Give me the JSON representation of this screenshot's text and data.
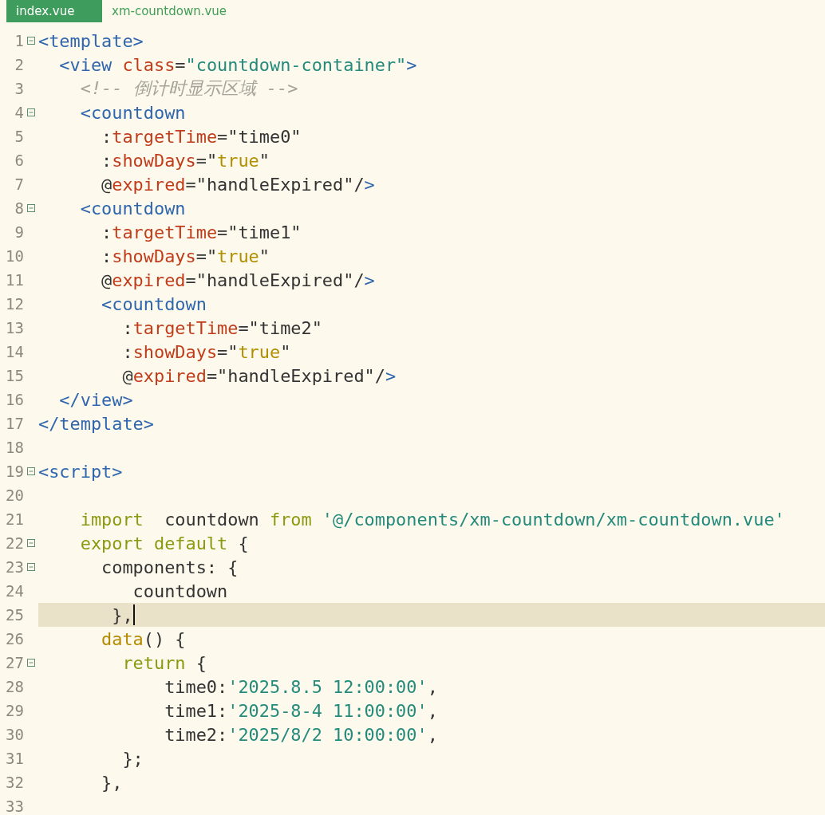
{
  "tabs": [
    {
      "label": "index.vue",
      "selected": true
    },
    {
      "label": "xm-countdown.vue",
      "selected": false
    }
  ],
  "editor": {
    "lines": [
      {
        "number": "1",
        "fold": true,
        "current": false,
        "tokens": [
          {
            "kind": "tag",
            "text": "<template>"
          }
        ]
      },
      {
        "number": "2",
        "fold": false,
        "current": false,
        "tokens": [
          {
            "kind": "tag",
            "text": "  <view "
          },
          {
            "kind": "attr",
            "text": "class"
          },
          {
            "kind": "plain",
            "text": "="
          },
          {
            "kind": "string",
            "text": "\"countdown-container\""
          },
          {
            "kind": "tag",
            "text": ">"
          }
        ]
      },
      {
        "number": "3",
        "fold": false,
        "current": false,
        "tokens": [
          {
            "kind": "comment",
            "text": "    <!-- 倒计时显示区域 -->"
          }
        ]
      },
      {
        "number": "4",
        "fold": true,
        "current": false,
        "tokens": [
          {
            "kind": "tag",
            "text": "    <countdown"
          }
        ]
      },
      {
        "number": "5",
        "fold": false,
        "current": false,
        "tokens": [
          {
            "kind": "plain",
            "text": "      :"
          },
          {
            "kind": "attr",
            "text": "targetTime"
          },
          {
            "kind": "plain",
            "text": "=\"time0\""
          }
        ]
      },
      {
        "number": "6",
        "fold": false,
        "current": false,
        "tokens": [
          {
            "kind": "plain",
            "text": "      :"
          },
          {
            "kind": "attr",
            "text": "showDays"
          },
          {
            "kind": "plain",
            "text": "=\""
          },
          {
            "kind": "bool",
            "text": "true"
          },
          {
            "kind": "plain",
            "text": "\""
          }
        ]
      },
      {
        "number": "7",
        "fold": false,
        "current": false,
        "tokens": [
          {
            "kind": "plain",
            "text": "      @"
          },
          {
            "kind": "attr",
            "text": "expired"
          },
          {
            "kind": "plain",
            "text": "=\"handleExpired\"/"
          },
          {
            "kind": "tag",
            "text": ">"
          }
        ]
      },
      {
        "number": "8",
        "fold": true,
        "current": false,
        "tokens": [
          {
            "kind": "tag",
            "text": "    <countdown"
          }
        ]
      },
      {
        "number": "9",
        "fold": false,
        "current": false,
        "tokens": [
          {
            "kind": "plain",
            "text": "      :"
          },
          {
            "kind": "attr",
            "text": "targetTime"
          },
          {
            "kind": "plain",
            "text": "=\"time1\""
          }
        ]
      },
      {
        "number": "10",
        "fold": false,
        "current": false,
        "tokens": [
          {
            "kind": "plain",
            "text": "      :"
          },
          {
            "kind": "attr",
            "text": "showDays"
          },
          {
            "kind": "plain",
            "text": "=\""
          },
          {
            "kind": "bool",
            "text": "true"
          },
          {
            "kind": "plain",
            "text": "\""
          }
        ]
      },
      {
        "number": "11",
        "fold": false,
        "current": false,
        "tokens": [
          {
            "kind": "plain",
            "text": "      @"
          },
          {
            "kind": "attr",
            "text": "expired"
          },
          {
            "kind": "plain",
            "text": "=\"handleExpired\"/"
          },
          {
            "kind": "tag",
            "text": ">"
          }
        ]
      },
      {
        "number": "12",
        "fold": false,
        "current": false,
        "tokens": [
          {
            "kind": "tag",
            "text": "      <countdown"
          }
        ]
      },
      {
        "number": "13",
        "fold": false,
        "current": false,
        "tokens": [
          {
            "kind": "plain",
            "text": "        :"
          },
          {
            "kind": "attr",
            "text": "targetTime"
          },
          {
            "kind": "plain",
            "text": "=\"time2\""
          }
        ]
      },
      {
        "number": "14",
        "fold": false,
        "current": false,
        "tokens": [
          {
            "kind": "plain",
            "text": "        :"
          },
          {
            "kind": "attr",
            "text": "showDays"
          },
          {
            "kind": "plain",
            "text": "=\""
          },
          {
            "kind": "bool",
            "text": "true"
          },
          {
            "kind": "plain",
            "text": "\""
          }
        ]
      },
      {
        "number": "15",
        "fold": false,
        "current": false,
        "tokens": [
          {
            "kind": "plain",
            "text": "        @"
          },
          {
            "kind": "attr",
            "text": "expired"
          },
          {
            "kind": "plain",
            "text": "=\"handleExpired\"/"
          },
          {
            "kind": "tag",
            "text": ">"
          }
        ]
      },
      {
        "number": "16",
        "fold": false,
        "current": false,
        "tokens": [
          {
            "kind": "tag",
            "text": "  </view>"
          }
        ]
      },
      {
        "number": "17",
        "fold": false,
        "current": false,
        "tokens": [
          {
            "kind": "tag",
            "text": "</template>"
          }
        ]
      },
      {
        "number": "18",
        "fold": false,
        "current": false
      },
      {
        "number": "19",
        "fold": true,
        "current": false,
        "tokens": [
          {
            "kind": "tag",
            "text": "<script>"
          }
        ]
      },
      {
        "number": "20",
        "fold": false,
        "current": false
      },
      {
        "number": "21",
        "fold": false,
        "current": false,
        "tokens": [
          {
            "kind": "keyword",
            "text": "    import"
          },
          {
            "kind": "plain",
            "text": "  countdown "
          },
          {
            "kind": "keyword",
            "text": "from"
          },
          {
            "kind": "string",
            "text": " '@/components/xm-countdown/xm-countdown.vue'"
          }
        ]
      },
      {
        "number": "22",
        "fold": true,
        "current": false,
        "tokens": [
          {
            "kind": "keyword",
            "text": "    export default"
          },
          {
            "kind": "plain",
            "text": " {"
          }
        ]
      },
      {
        "number": "23",
        "fold": true,
        "current": false,
        "tokens": [
          {
            "kind": "plain",
            "text": "      components: {"
          }
        ]
      },
      {
        "number": "24",
        "fold": false,
        "current": false,
        "tokens": [
          {
            "kind": "plain",
            "text": "         countdown"
          }
        ]
      },
      {
        "number": "25",
        "fold": false,
        "current": true,
        "tokens": [
          {
            "kind": "plain",
            "text": "       },"
          }
        ]
      },
      {
        "number": "26",
        "fold": false,
        "current": false,
        "tokens": [
          {
            "kind": "func",
            "text": "      data"
          },
          {
            "kind": "plain",
            "text": "() {"
          }
        ]
      },
      {
        "number": "27",
        "fold": true,
        "current": false,
        "tokens": [
          {
            "kind": "keyword",
            "text": "        return"
          },
          {
            "kind": "plain",
            "text": " {"
          }
        ]
      },
      {
        "number": "28",
        "fold": false,
        "current": false,
        "tokens": [
          {
            "kind": "plain",
            "text": "            time0:"
          },
          {
            "kind": "string",
            "text": "'2025.8.5 12:00:00'"
          },
          {
            "kind": "plain",
            "text": ","
          }
        ]
      },
      {
        "number": "29",
        "fold": false,
        "current": false,
        "tokens": [
          {
            "kind": "plain",
            "text": "            time1:"
          },
          {
            "kind": "string",
            "text": "'2025-8-4 11:00:00'"
          },
          {
            "kind": "plain",
            "text": ","
          }
        ]
      },
      {
        "number": "30",
        "fold": false,
        "current": false,
        "tokens": [
          {
            "kind": "plain",
            "text": "            time2:"
          },
          {
            "kind": "string",
            "text": "'2025/8/2 10:00:00'"
          },
          {
            "kind": "plain",
            "text": ","
          }
        ]
      },
      {
        "number": "31",
        "fold": false,
        "current": false,
        "tokens": [
          {
            "kind": "plain",
            "text": "        };"
          }
        ]
      },
      {
        "number": "32",
        "fold": false,
        "current": false,
        "tokens": [
          {
            "kind": "plain",
            "text": "      },"
          }
        ]
      },
      {
        "number": "33",
        "fold": false,
        "current": false
      }
    ]
  }
}
